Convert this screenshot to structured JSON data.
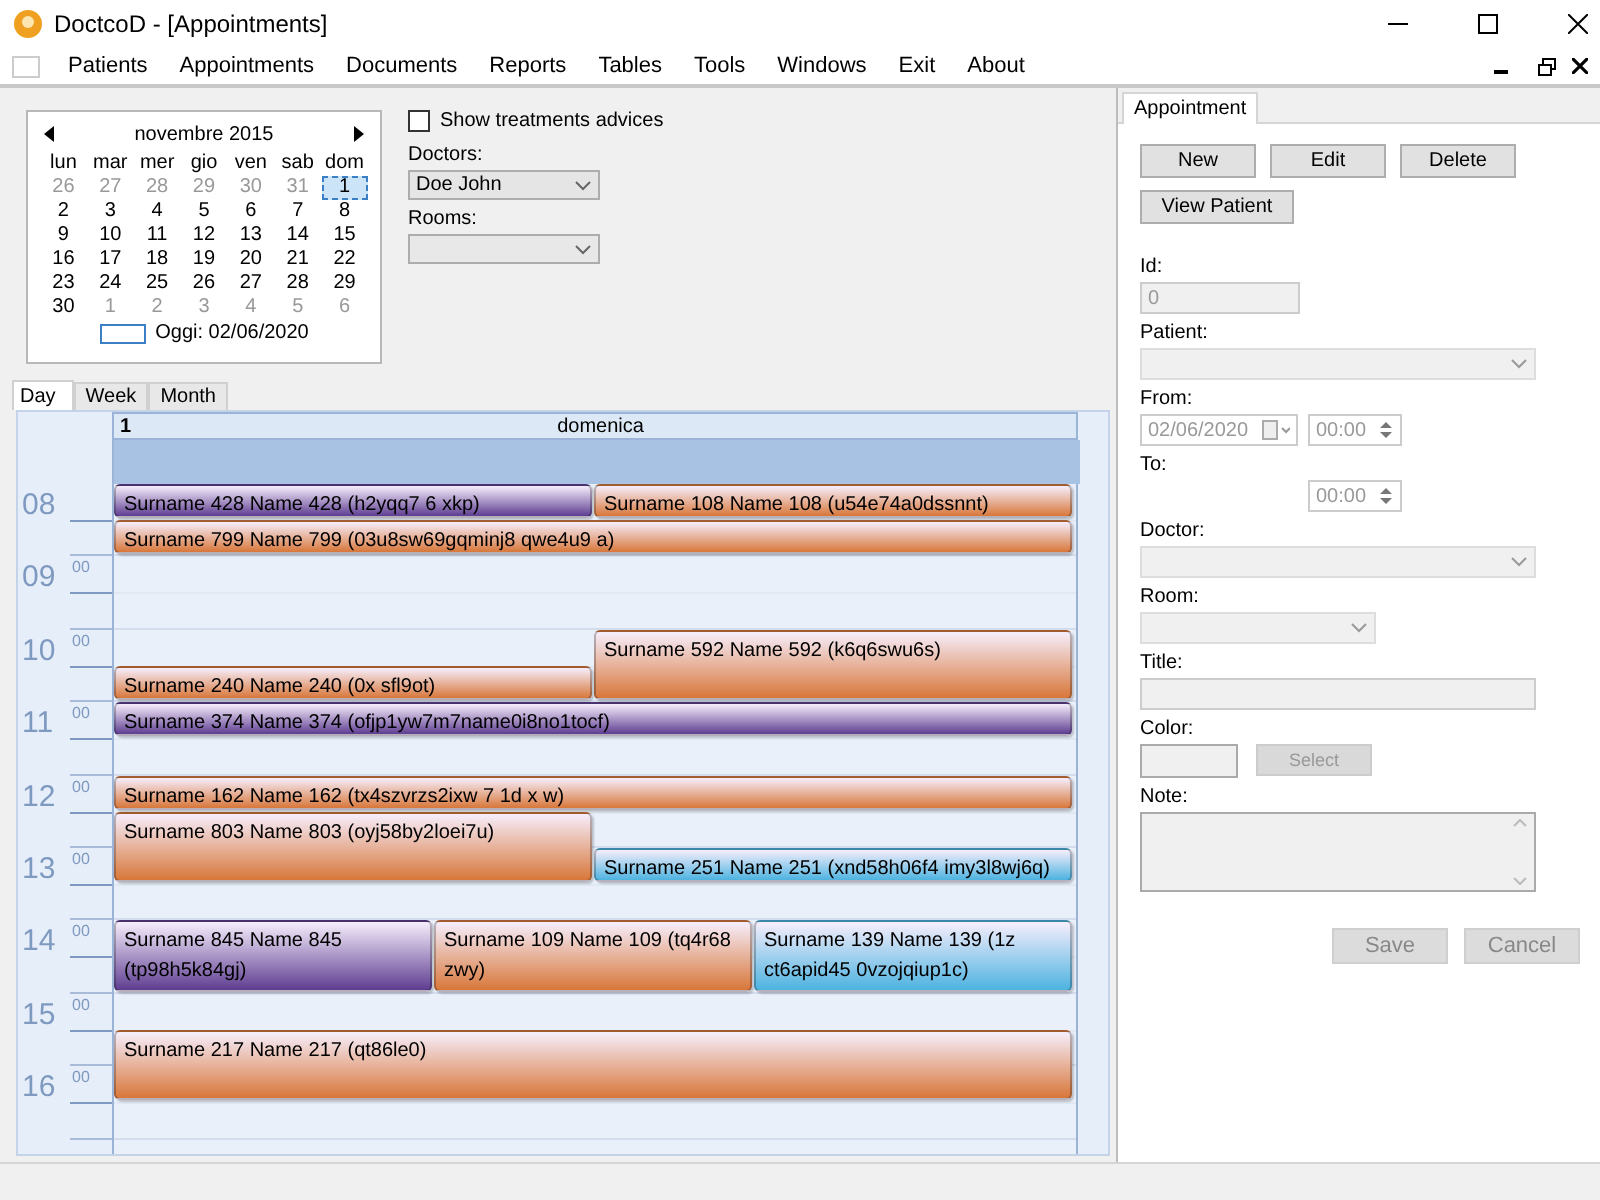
{
  "window": {
    "title": "DoctcoD - [Appointments]"
  },
  "menu": [
    "Patients",
    "Appointments",
    "Documents",
    "Reports",
    "Tables",
    "Tools",
    "Windows",
    "Exit",
    "About"
  ],
  "calendar": {
    "month": "novembre 2015",
    "weekdays": [
      "lun",
      "mar",
      "mer",
      "gio",
      "ven",
      "sab",
      "dom"
    ],
    "weeks": [
      [
        {
          "day": "26",
          "other_month": true,
          "selected": false
        },
        {
          "day": "27",
          "other_month": true,
          "selected": false
        },
        {
          "day": "28",
          "other_month": true,
          "selected": false
        },
        {
          "day": "29",
          "other_month": true,
          "selected": false
        },
        {
          "day": "30",
          "other_month": true,
          "selected": false
        },
        {
          "day": "31",
          "other_month": true,
          "selected": false
        },
        {
          "day": "1",
          "other_month": false,
          "selected": true
        }
      ],
      [
        {
          "day": "2",
          "other_month": false,
          "selected": false
        },
        {
          "day": "3",
          "other_month": false,
          "selected": false
        },
        {
          "day": "4",
          "other_month": false,
          "selected": false
        },
        {
          "day": "5",
          "other_month": false,
          "selected": false
        },
        {
          "day": "6",
          "other_month": false,
          "selected": false
        },
        {
          "day": "7",
          "other_month": false,
          "selected": false
        },
        {
          "day": "8",
          "other_month": false,
          "selected": false
        }
      ],
      [
        {
          "day": "9",
          "other_month": false,
          "selected": false
        },
        {
          "day": "10",
          "other_month": false,
          "selected": false
        },
        {
          "day": "11",
          "other_month": false,
          "selected": false
        },
        {
          "day": "12",
          "other_month": false,
          "selected": false
        },
        {
          "day": "13",
          "other_month": false,
          "selected": false
        },
        {
          "day": "14",
          "other_month": false,
          "selected": false
        },
        {
          "day": "15",
          "other_month": false,
          "selected": false
        }
      ],
      [
        {
          "day": "16",
          "other_month": false,
          "selected": false
        },
        {
          "day": "17",
          "other_month": false,
          "selected": false
        },
        {
          "day": "18",
          "other_month": false,
          "selected": false
        },
        {
          "day": "19",
          "other_month": false,
          "selected": false
        },
        {
          "day": "20",
          "other_month": false,
          "selected": false
        },
        {
          "day": "21",
          "other_month": false,
          "selected": false
        },
        {
          "day": "22",
          "other_month": false,
          "selected": false
        }
      ],
      [
        {
          "day": "23",
          "other_month": false,
          "selected": false
        },
        {
          "day": "24",
          "other_month": false,
          "selected": false
        },
        {
          "day": "25",
          "other_month": false,
          "selected": false
        },
        {
          "day": "26",
          "other_month": false,
          "selected": false
        },
        {
          "day": "27",
          "other_month": false,
          "selected": false
        },
        {
          "day": "28",
          "other_month": false,
          "selected": false
        },
        {
          "day": "29",
          "other_month": false,
          "selected": false
        }
      ],
      [
        {
          "day": "30",
          "other_month": false,
          "selected": false
        },
        {
          "day": "1",
          "other_month": true,
          "selected": false
        },
        {
          "day": "2",
          "other_month": true,
          "selected": false
        },
        {
          "day": "3",
          "other_month": true,
          "selected": false
        },
        {
          "day": "4",
          "other_month": true,
          "selected": false
        },
        {
          "day": "5",
          "other_month": true,
          "selected": false
        },
        {
          "day": "6",
          "other_month": true,
          "selected": false
        }
      ]
    ],
    "today": "Oggi: 02/06/2020"
  },
  "options": {
    "show_treatments": {
      "label": "Show treatments advices",
      "checked": false
    },
    "doctors": {
      "label": "Doctors:",
      "value": "Doe John"
    },
    "rooms": {
      "label": "Rooms:"
    }
  },
  "view_tabs": [
    {
      "label": "Day",
      "selected": true
    },
    {
      "label": "Week",
      "selected": false
    },
    {
      "label": "Month",
      "selected": false
    }
  ],
  "day_view": {
    "day_number": "1",
    "day_name": "domenica",
    "hours": [
      {
        "hour": "08",
        "appointments": [
          {
            "text": "Surname 428 Name 428 (h2yqq7 6 xkp)",
            "color": "#5e3d91",
            "kind": "left",
            "late": false,
            "long": false
          },
          {
            "text": "Surname 108 Name 108 (u54e74a0dssnnt)",
            "color": "#d8773a",
            "kind": "right",
            "late": false,
            "long": false
          },
          {
            "text": "Surname 799 Name 799 (03u8sw69gqminj8 qwe4u9 a)",
            "color": "#d8773a",
            "kind": "full",
            "late": true,
            "long": false
          }
        ]
      },
      {
        "hour": "09",
        "minutes": "00"
      },
      {
        "hour": "10",
        "minutes": "00",
        "appointments": [
          {
            "text": "Surname 592 Name 592 (k6q6swu6s)",
            "color": "#d8773a",
            "kind": "right",
            "late": false,
            "long": true
          },
          {
            "text": "Surname 240 Name 240 (0x sfl9ot)",
            "color": "#d8773a",
            "kind": "left",
            "late": true,
            "long": false
          }
        ]
      },
      {
        "hour": "11",
        "minutes": "00",
        "appointments": [
          {
            "text": "Surname 374 Name 374 (ofjp1yw7m7name0i8no1tocf)",
            "color": "#5e3d91",
            "kind": "full",
            "late": false,
            "long": false
          }
        ]
      },
      {
        "hour": "12",
        "minutes": "00",
        "appointments": [
          {
            "text": "Surname 162 Name 162 (tx4szvrzs2ixw 7 1d x w)",
            "color": "#d8773a",
            "kind": "full",
            "late": false,
            "long": false
          },
          {
            "text": "Surname 803 Name 803 (oyj58by2loei7u)",
            "color": "#d8773a",
            "kind": "left",
            "late": true,
            "long": true
          }
        ]
      },
      {
        "hour": "13",
        "minutes": "00",
        "appointments": [
          {
            "text": "Surname 251 Name 251 (xnd58h06f4 imy3l8wj6q)",
            "color": "#4db3e0",
            "kind": "right",
            "late": false,
            "long": false
          }
        ]
      },
      {
        "hour": "14",
        "minutes": "00",
        "appointments": [
          {
            "text": "Surname 845 Name 845 (tp98h5k84gj)",
            "color": "#5e3d91",
            "kind": "first",
            "late": false,
            "long": true
          },
          {
            "text": "Surname 109 Name 109 (tq4r68 zwy)",
            "color": "#d8773a",
            "kind": "second",
            "late": false,
            "long": true
          },
          {
            "text": "Surname 139 Name 139 (1z ct6apid45 0vzojqiup1c)",
            "color": "#4db3e0",
            "kind": "third",
            "late": false,
            "long": true
          }
        ]
      },
      {
        "hour": "15",
        "minutes": "00",
        "appointments": [
          {
            "text": "Surname 217 Name 217 (qt86le0)",
            "color": "#d8773a",
            "kind": "full",
            "late": true,
            "long": true
          }
        ]
      },
      {
        "hour": "16",
        "minutes": "00"
      }
    ]
  },
  "appointment_panel": {
    "tab": "Appointment",
    "buttons": [
      "New",
      "Edit",
      "Delete"
    ],
    "view_patient": "View Patient",
    "id": {
      "label": "Id:",
      "value": "0"
    },
    "patient": {
      "label": "Patient:"
    },
    "from": {
      "label": "From:",
      "date": "02/06/2020",
      "time": "00:00"
    },
    "to": {
      "label": "To:",
      "time": "00:00"
    },
    "doctor": {
      "label": "Doctor:"
    },
    "room": {
      "label": "Room:"
    },
    "title": {
      "label": "Title:"
    },
    "color": {
      "label": "Color:",
      "button": "Select"
    },
    "note": {
      "label": "Note:"
    },
    "save": "Save",
    "cancel": "Cancel"
  }
}
